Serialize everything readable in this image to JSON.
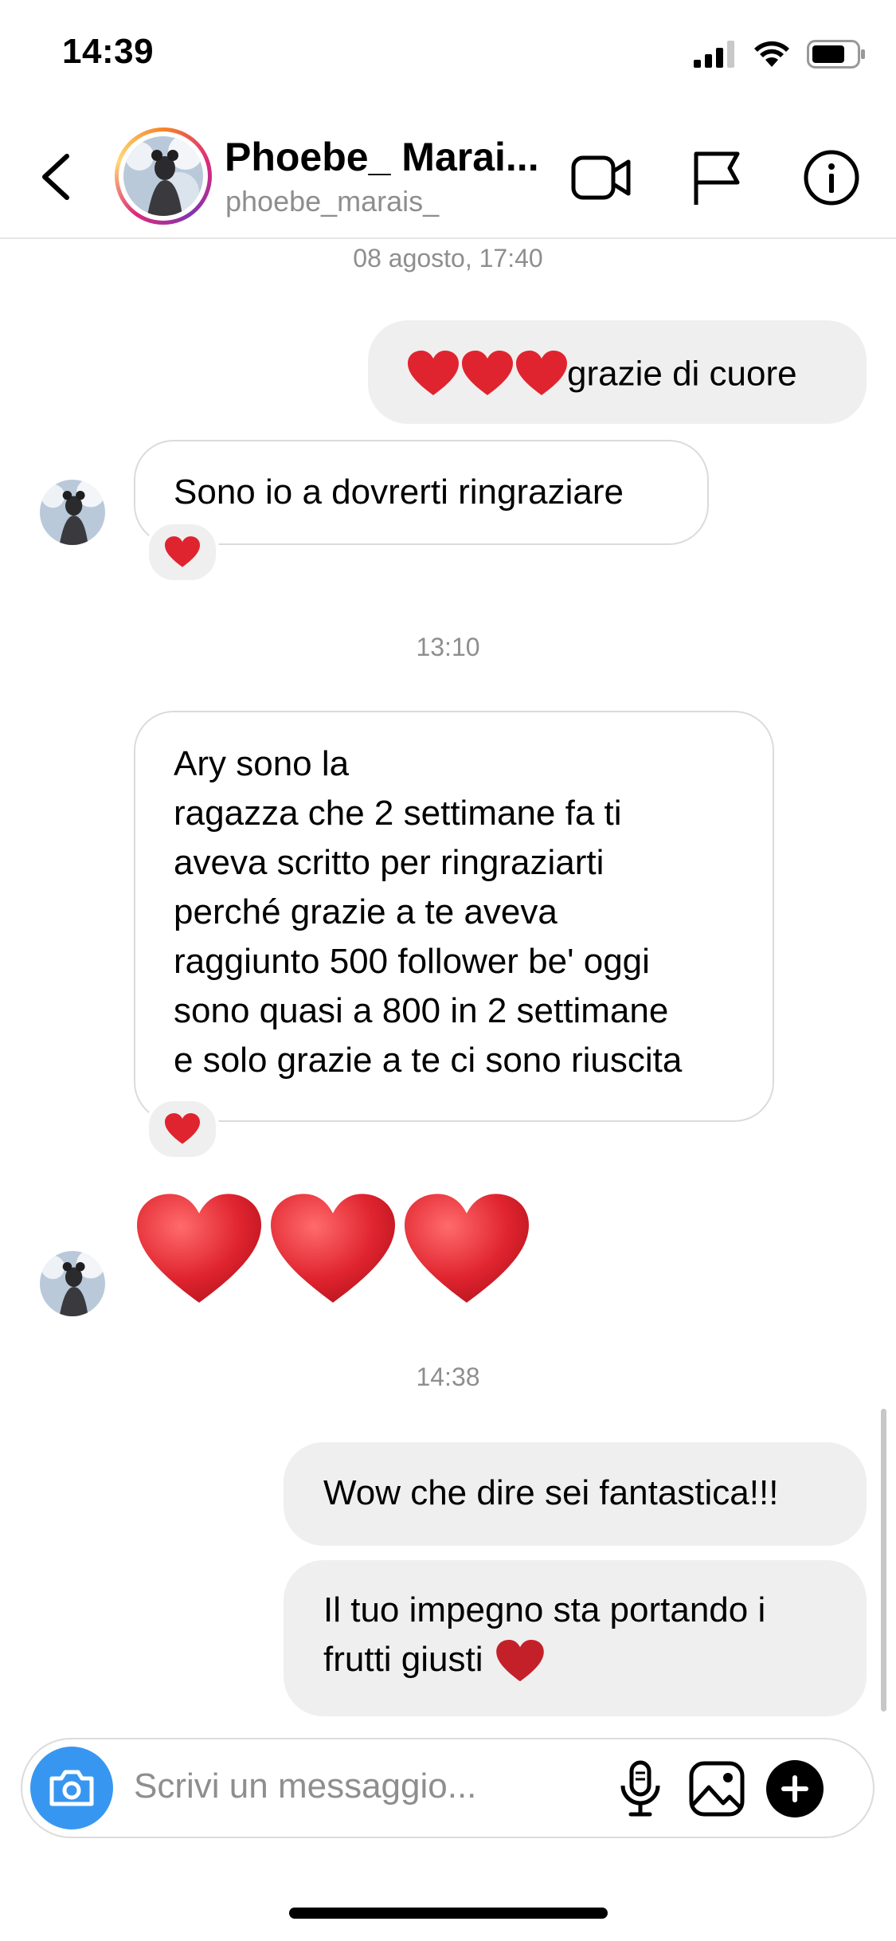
{
  "status": {
    "time": "14:39"
  },
  "header": {
    "name": "Phoebe_ Marai...",
    "handle": "phoebe_marais_",
    "icons": [
      "back-chevron-icon",
      "video-camera-icon",
      "flag-icon",
      "info-icon"
    ]
  },
  "chat": {
    "time_1": "08 agosto, 17:40",
    "msg_out_1": "grazie di cuore",
    "msg_in_1": "Sono io a dovrerti ringraziare",
    "time_2": "13:10",
    "msg_in_2_lines": [
      "Ary sono la",
      "ragazza che 2 settimane fa  ti",
      "aveva scritto per ringraziarti",
      "perché grazie a te aveva",
      "raggiunto 500 follower be' oggi",
      "sono quasi a 800 in 2 settimane",
      "e solo grazie a te ci sono riuscita"
    ],
    "time_3": "14:38",
    "msg_out_2": "Wow che dire sei fantastica!!!",
    "msg_out_3_line1": "Il tuo impegno sta portando i",
    "msg_out_3_line2": "frutti giusti",
    "heart_color": "#e0242f"
  },
  "composer": {
    "placeholder": "Scrivi un messaggio...",
    "icons": [
      "camera-icon",
      "microphone-icon",
      "image-icon",
      "plus-icon"
    ],
    "accent": "#3797f0"
  }
}
